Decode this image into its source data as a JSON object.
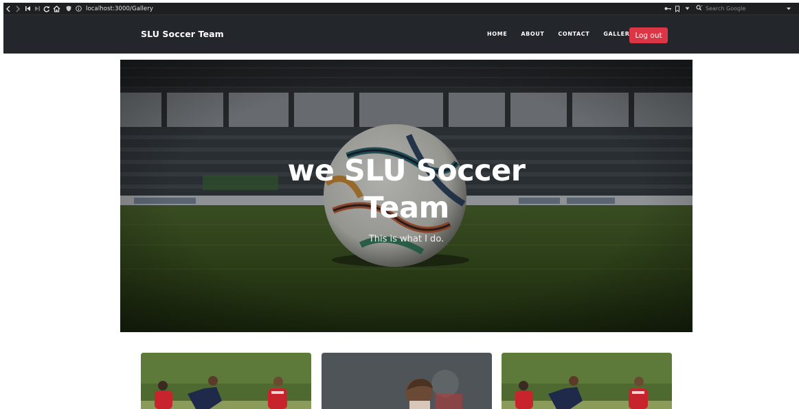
{
  "browser": {
    "url": "localhost:3000/Gallery",
    "search_placeholder": "Search Google"
  },
  "navbar": {
    "brand": "SLU Soccer Team",
    "links": [
      {
        "label": "HOME"
      },
      {
        "label": "ABOUT"
      },
      {
        "label": "CONTACT"
      },
      {
        "label": "GALLERY"
      }
    ],
    "logout_label": "Log out"
  },
  "hero": {
    "title_line1": "we SLU Soccer",
    "title_line2": "Team",
    "subtitle": "This is what I do."
  },
  "gallery": {
    "cards": [
      {
        "image": "soccer-players-photo"
      },
      {
        "image": "soccer-player-portrait-photo"
      },
      {
        "image": "soccer-players-photo"
      }
    ]
  },
  "colors": {
    "browser_chrome": "#1d1f21",
    "navbar": "#23262a",
    "logout_button": "#dc3545",
    "text_light": "#ffffff"
  }
}
